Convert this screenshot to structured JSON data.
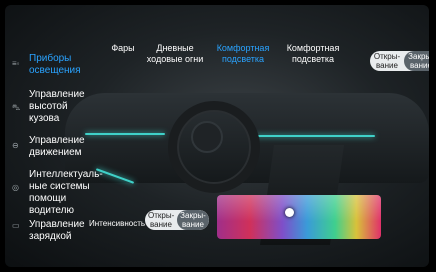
{
  "sidebar": {
    "items": [
      {
        "label": "Приборы освещения",
        "icon": "light-icon",
        "active": true
      },
      {
        "label": "Управление высотой кузова",
        "icon": "car-height-icon",
        "active": false
      },
      {
        "label": "Управление движением",
        "icon": "steering-icon",
        "active": false
      },
      {
        "label": "Интеллектуаль-ные системы помощи водителю",
        "icon": "assist-icon",
        "active": false
      },
      {
        "label": "Управление зарядкой",
        "icon": "battery-icon",
        "active": false
      }
    ]
  },
  "tabs": [
    {
      "label": "Фары",
      "active": false
    },
    {
      "label": "Дневные ходовые огни",
      "active": false
    },
    {
      "label": "Комфортная подсветка",
      "active": true
    },
    {
      "label": "Комфортная подсветка",
      "active": false
    }
  ],
  "door_toggle": {
    "open": "Откры-вание",
    "close": "Закры-вание",
    "selected": "close"
  },
  "intensity": {
    "label": "Интенсивность",
    "open": "Откры-вание",
    "close": "Закры-вание",
    "selected": "close"
  },
  "colors": {
    "accent": "#2aa3ff",
    "ambient": "#3fd0c8"
  }
}
